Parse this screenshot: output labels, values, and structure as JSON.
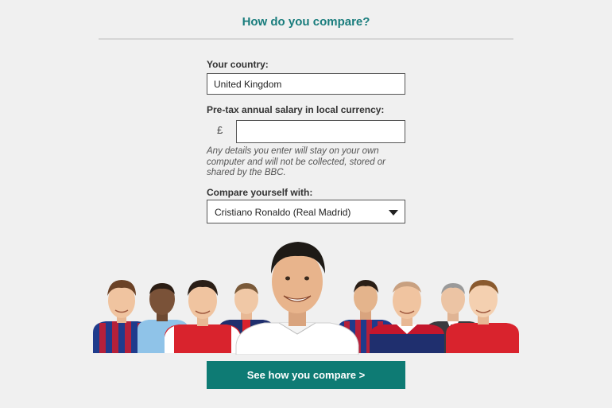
{
  "header": {
    "title": "How do you compare?"
  },
  "form": {
    "country_label": "Your country:",
    "country_value": "United Kingdom",
    "salary_label": "Pre-tax annual salary in local currency:",
    "currency_symbol": "£",
    "salary_value": "",
    "privacy_note": "Any details you enter will stay on your own\ncomputer and will not be collected, stored or\nshared by the BBC.",
    "compare_label": "Compare yourself with:",
    "compare_selected": "Cristiano Ronaldo (Real Madrid)"
  },
  "cta": {
    "label": "See how you compare >"
  },
  "colors": {
    "accent": "#1a7d7d",
    "button": "#0e7b74",
    "barcelona_blue": "#1f3b8c",
    "barcelona_red": "#b5203a",
    "arsenal_red": "#d9232d"
  }
}
